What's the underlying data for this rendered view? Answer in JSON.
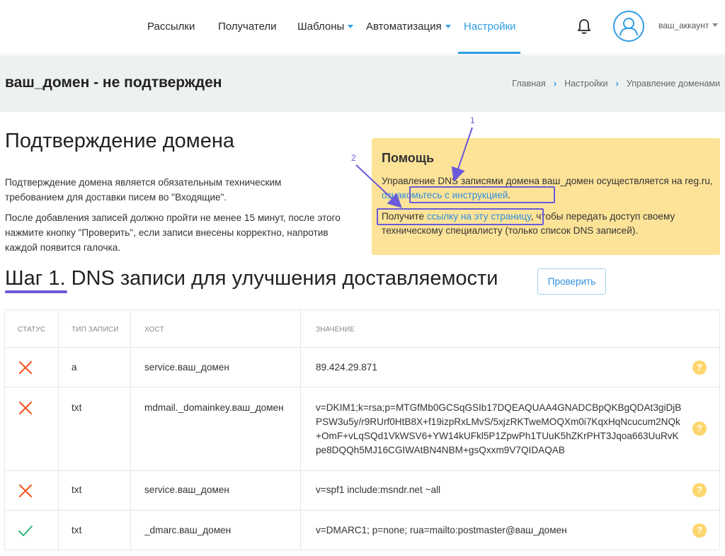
{
  "nav": {
    "items": [
      {
        "label": "Рассылки"
      },
      {
        "label": "Получатели"
      },
      {
        "label": "Шаблоны"
      },
      {
        "label": "Автоматизация"
      },
      {
        "label": "Настройки"
      }
    ],
    "account": "ваш_аккаунт",
    "active_color": "#2f9de4"
  },
  "titlebar": {
    "title": "ваш_домен - не подтвержден",
    "breadcrumb": [
      "Главная",
      "Настройки",
      "Управление доменами"
    ]
  },
  "main": {
    "heading": "Подтверждение домена",
    "para1": "Подтверждение домена является обязательным техническим требованием для доставки писем во \"Входящие\".",
    "para2": "После добавления записей должно пройти не менее 15 минут, после этого нажмите кнопку \"Проверить\", если записи внесены корректно, напротив каждой появится галочка."
  },
  "help": {
    "title": "Помощь",
    "line1_prefix": "Управление DNS записями домена ваш_домен осуществляется на reg.ru,",
    "line1_link": "ознакомьтесь с инструкцией",
    "line1_suffix": ".",
    "line2_prefix": "Получите",
    "line2_link": "ссылку на эту страницу",
    "line2_suffix": ", чтобы передать доступ своему техническому специалисту (только список DNS записей).",
    "bg_color": "#fde398"
  },
  "annotations": {
    "one": "1",
    "two": "2",
    "color": "#6a5bd8"
  },
  "step": {
    "heading_a": "Шаг 1.",
    "heading_b": "DNS записи для улучшения доставляемости",
    "check_button": "Проверить"
  },
  "table": {
    "headers": [
      "Статус",
      "Тип записи",
      "Хост",
      "Значение"
    ],
    "rows": [
      {
        "status": "error",
        "type": "a",
        "host": "service.ваш_домен",
        "value": "89.424.29.871"
      },
      {
        "status": "error",
        "type": "txt",
        "host": "mdmail._domainkey.ваш_домен",
        "value": "v=DKIM1;k=rsa;p=MTGfMb0GCSqGSIb17DQEAQUAA4GNADCBpQKBgQDAt3giDjBPSW3u5y/r9RUrf0HtB8X+f19izpRxLMvS/5xjzRKTweMOQXm0i7KqxHqNcucum2NQk+OmF+vLqSQd1VkWSV6+YW14kUFkl5P1ZpwPh1TUuK5hZKrPHT3Jqoa663UuRvKpe8DQQh5MJ16CGIWAtBN4NBM+gsQxxm9V7QIDAQAB"
      },
      {
        "status": "error",
        "type": "txt",
        "host": "service.ваш_домен",
        "value": "v=spf1 include:msndr.net ~all"
      },
      {
        "status": "ok",
        "type": "txt",
        "host": "_dmarc.ваш_домен",
        "value": "v=DMARC1; p=none; rua=mailto:postmaster@ваш_домен"
      }
    ],
    "help_glyph": "?",
    "error_color": "#f05a28",
    "ok_color": "#2bb673"
  }
}
